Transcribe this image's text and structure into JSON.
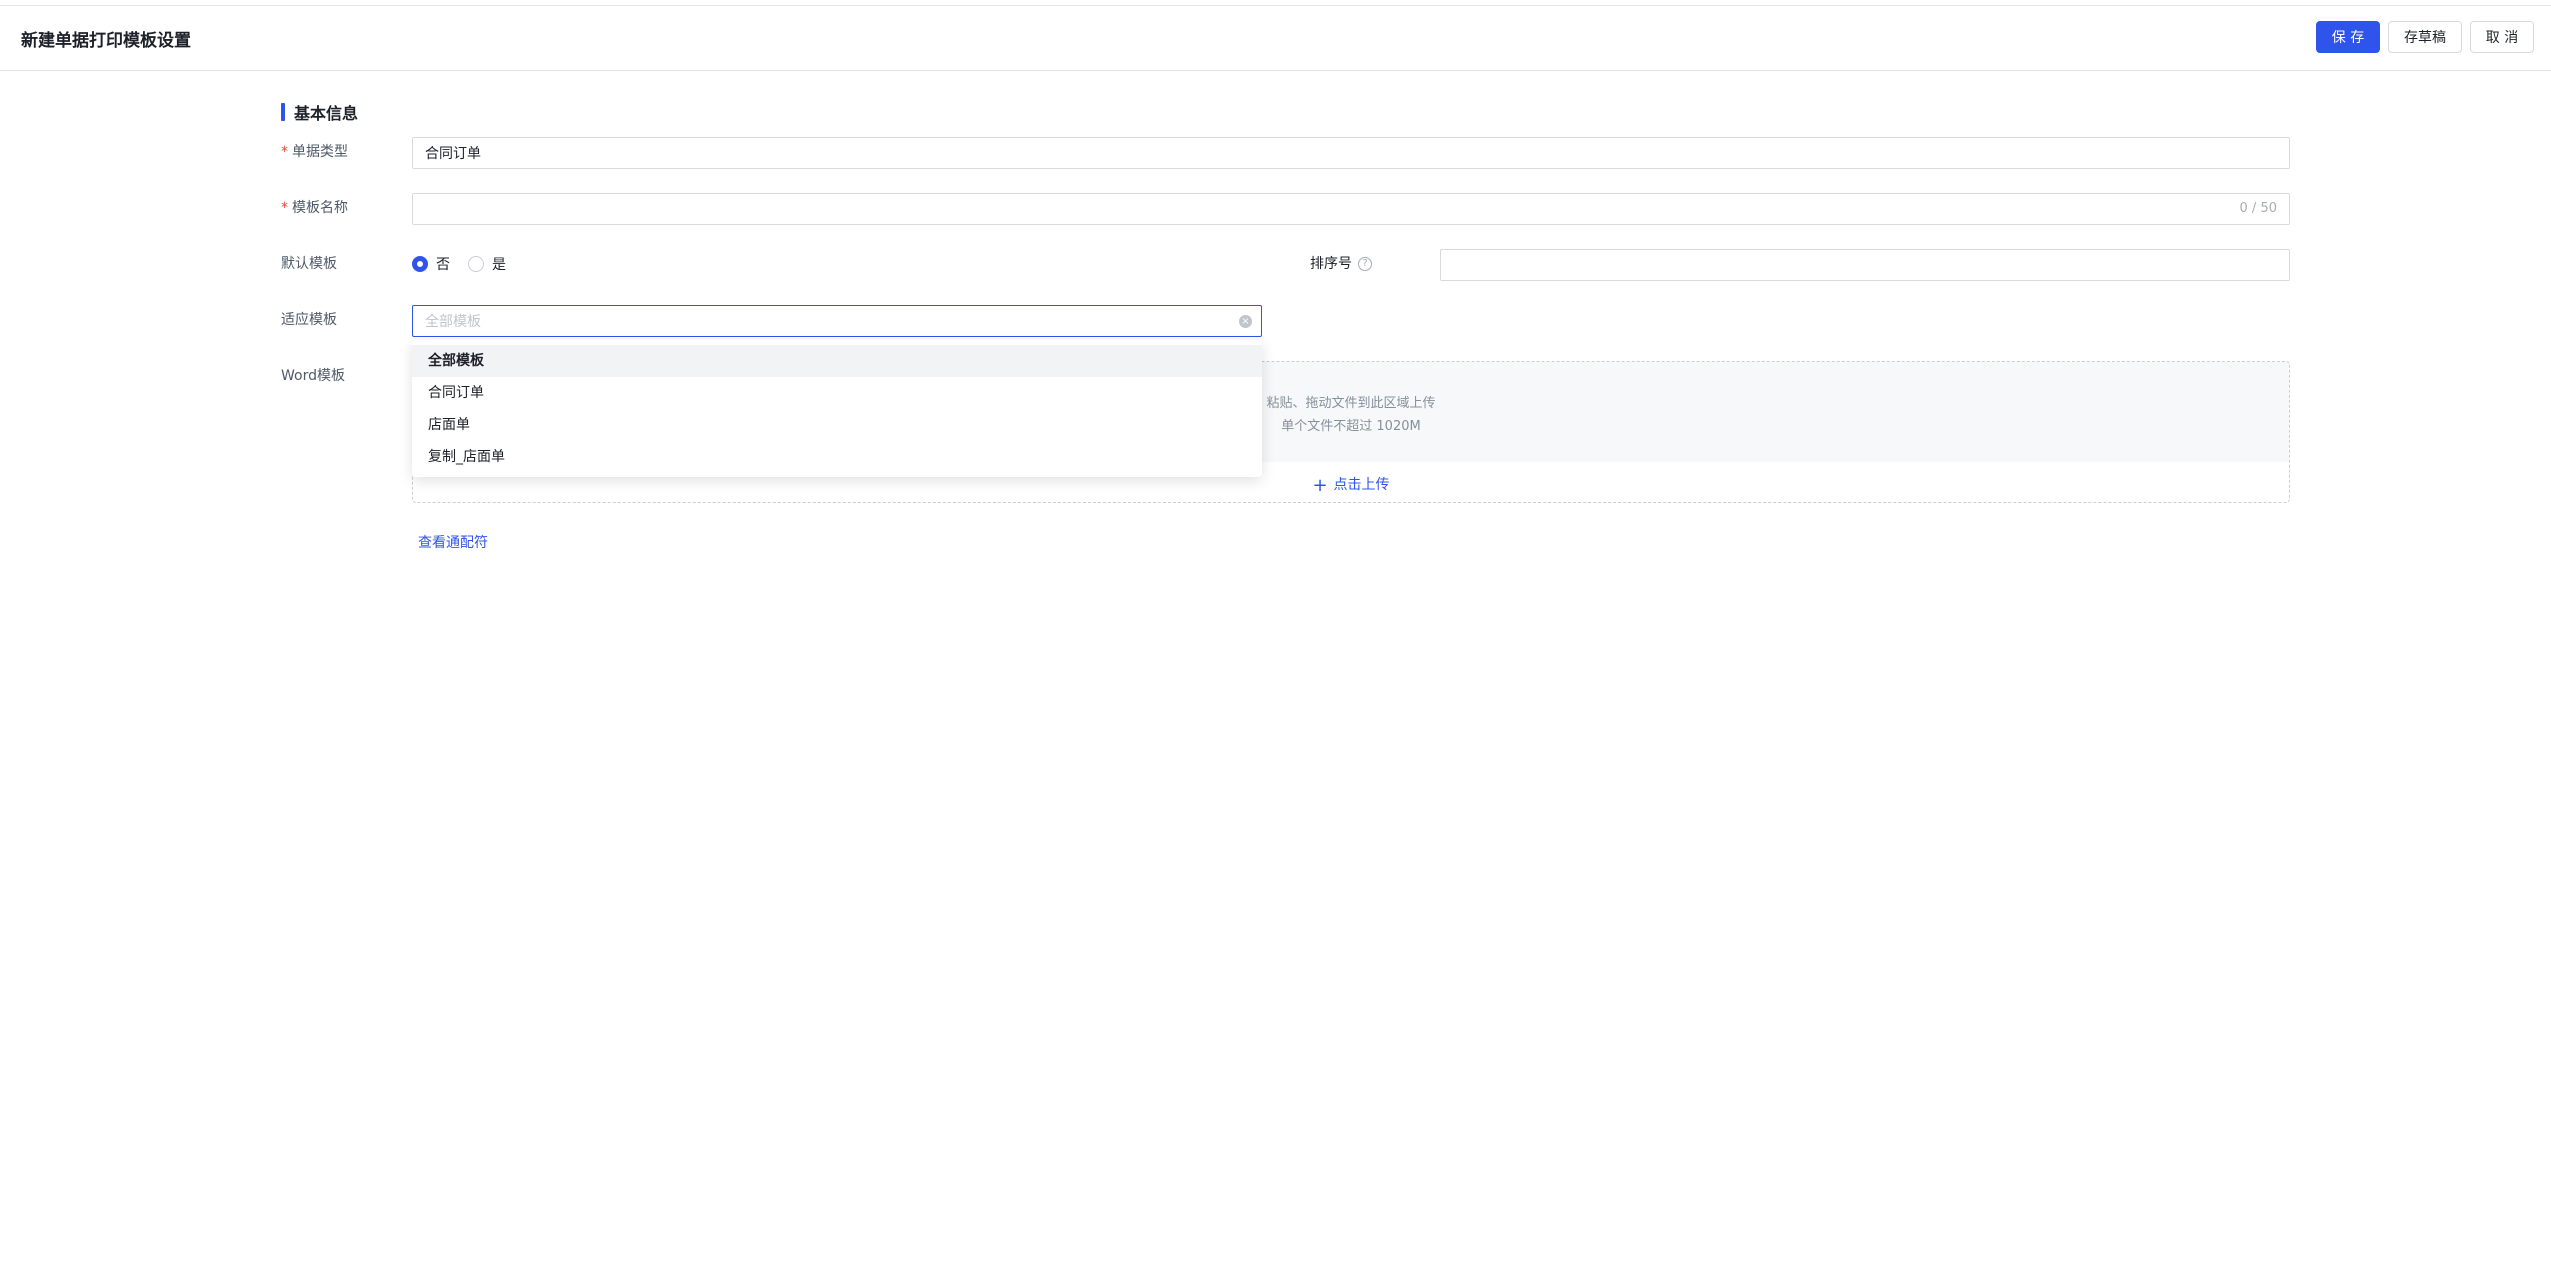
{
  "header": {
    "title": "新建单据打印模板设置",
    "save_label": "保 存",
    "draft_label": "存草稿",
    "cancel_label": "取 消"
  },
  "section": {
    "title": "基本信息"
  },
  "form": {
    "doc_type": {
      "label": "单据类型",
      "value": "合同订单"
    },
    "template_name": {
      "label": "模板名称",
      "value": "",
      "counter": "0 / 50"
    },
    "default_template": {
      "label": "默认模板",
      "options": [
        "否",
        "是"
      ],
      "selected": "否"
    },
    "sort_no": {
      "label": "排序号",
      "value": ""
    },
    "adapt_template": {
      "label": "适应模板",
      "placeholder": "全部模板"
    },
    "word_template": {
      "label": "Word模板",
      "hint1": "粘贴、拖动文件到此区域上传",
      "hint2": "单个文件不超过 1020M",
      "upload_label": "点击上传"
    },
    "view_link": "查看通配符"
  },
  "dropdown": {
    "items": [
      "全部模板",
      "合同订单",
      "店面单",
      "复制_店面单"
    ],
    "active_index": 0
  },
  "colors": {
    "primary": "#2f54eb",
    "required": "#f53f3f"
  }
}
